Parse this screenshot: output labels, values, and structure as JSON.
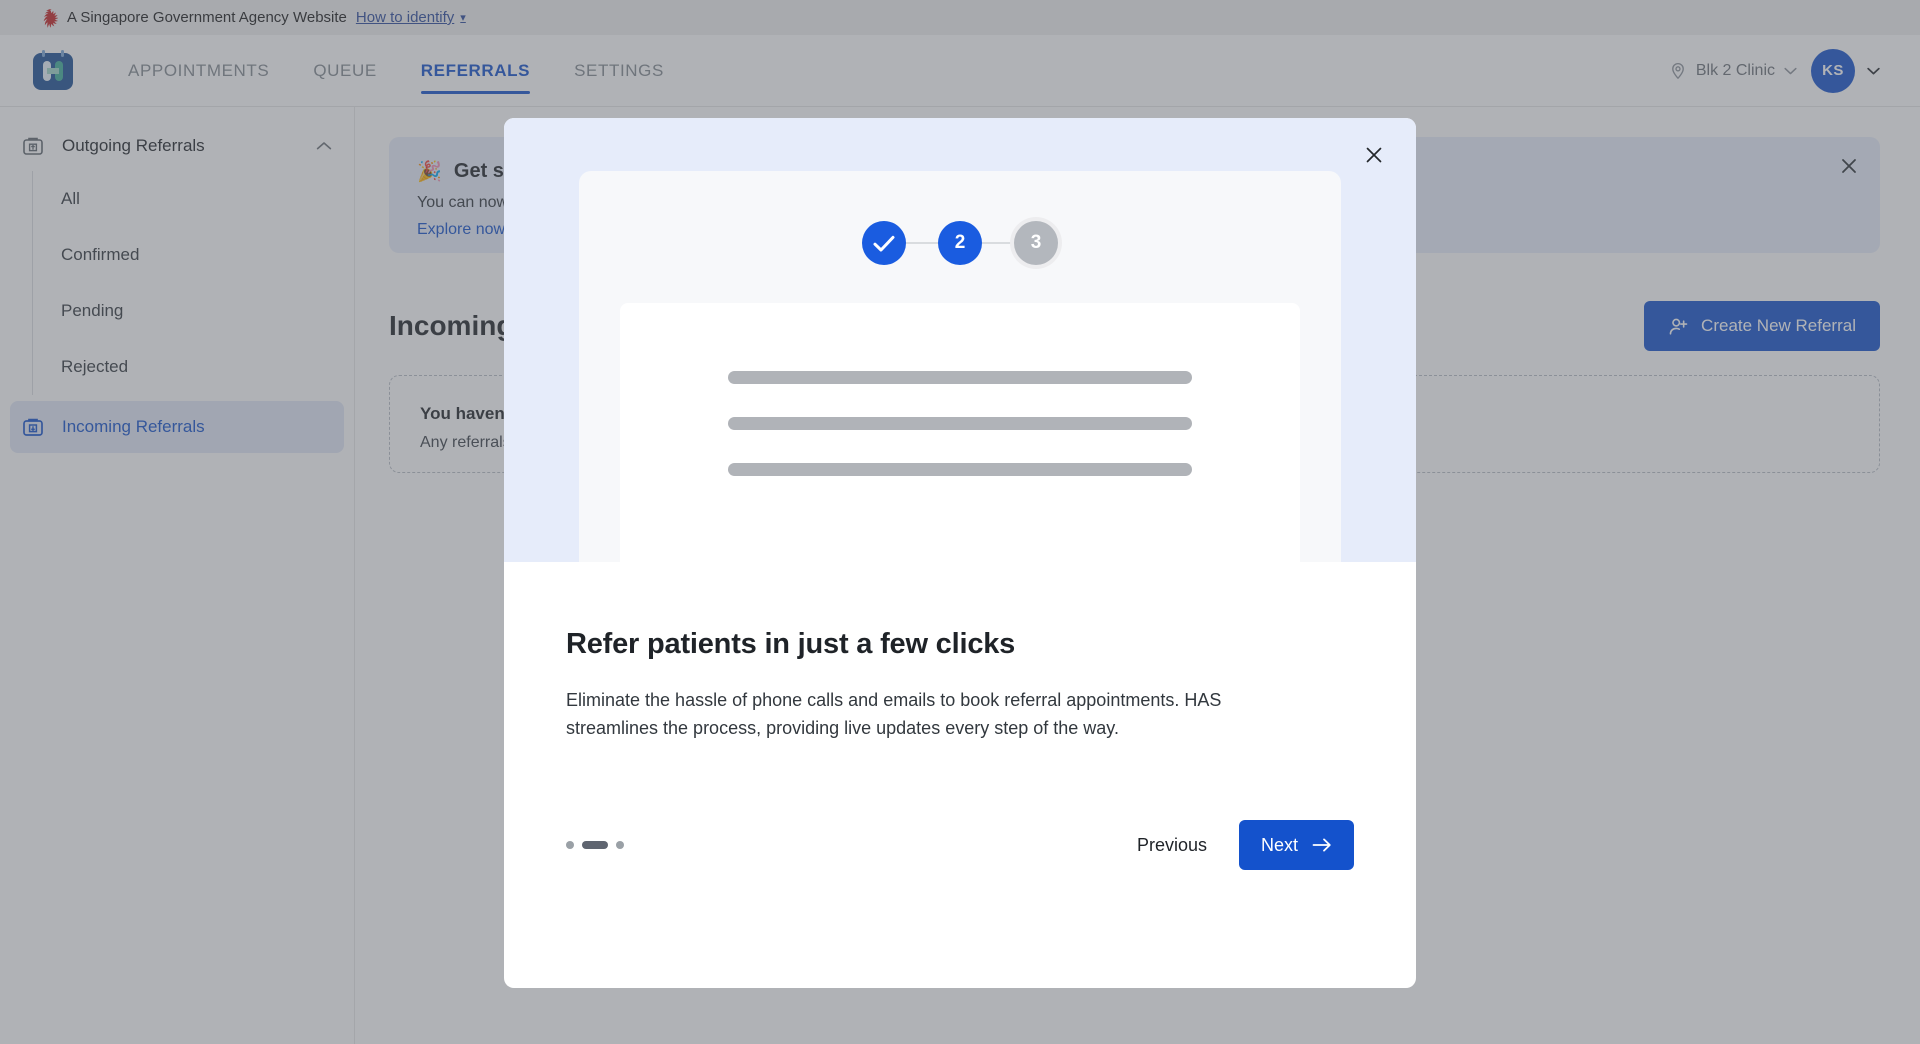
{
  "masthead": {
    "text": "A Singapore Government Agency Website",
    "link_label": "How to identify",
    "lion_icon": "singapore-lion-crest-icon",
    "chevron": "▾"
  },
  "topnav": {
    "logo_icon": "has-app-logo-icon",
    "tabs": [
      {
        "label": "APPOINTMENTS",
        "active": false
      },
      {
        "label": "QUEUE",
        "active": false
      },
      {
        "label": "REFERRALS",
        "active": true
      },
      {
        "label": "SETTINGS",
        "active": false
      }
    ],
    "clinic": {
      "icon": "location-pin-icon",
      "label": "Blk 2 Clinic",
      "chevron_icon": "chevron-down-icon"
    },
    "user": {
      "initials": "KS",
      "chevron_icon": "chevron-down-icon"
    }
  },
  "sidebar": {
    "group": {
      "icon": "outgoing-referrals-icon",
      "label": "Outgoing Referrals",
      "chevron_icon": "chevron-up-icon"
    },
    "sub_items": [
      {
        "label": "All"
      },
      {
        "label": "Confirmed"
      },
      {
        "label": "Pending"
      },
      {
        "label": "Rejected"
      }
    ],
    "incoming": {
      "icon": "incoming-referrals-icon",
      "label": "Incoming Referrals",
      "active": true
    }
  },
  "main": {
    "banner": {
      "emoji": "🎉",
      "title": "Get started with Referrals",
      "text": "You can now create and manage referrals directly in HAS.",
      "link_label": "Explore now",
      "close_icon": "close-icon"
    },
    "section_title": "Incoming Referrals",
    "create_button": {
      "label": "Create New Referral",
      "icon": "user-plus-icon"
    },
    "empty_state": {
      "title": "You haven't received any referrals yet",
      "subtitle": "Any referrals sent to your clinic will appear here."
    }
  },
  "modal": {
    "close_icon": "close-icon",
    "stepper": {
      "steps": [
        {
          "label": "✓",
          "state": "done"
        },
        {
          "label": "2",
          "state": "current"
        },
        {
          "label": "3",
          "state": "todo"
        }
      ]
    },
    "skeleton_lines": 3,
    "title": "Refer patients in just a few clicks",
    "description": "Eliminate the hassle of phone calls and emails to book referral appointments. HAS streamlines the process, providing live updates every step of the way.",
    "carousel": {
      "total": 3,
      "active_index": 1
    },
    "previous_label": "Previous",
    "next_label": "Next",
    "next_arrow_icon": "arrow-right-icon"
  },
  "colors": {
    "brand_blue": "#1452cc",
    "step_blue": "#1a5ce0",
    "hero_bg": "#e6ecfa",
    "banner_bg": "#e8eefb",
    "sidebar_active_bg": "#e2e9f7",
    "gray_step": "#b3b7bd"
  }
}
